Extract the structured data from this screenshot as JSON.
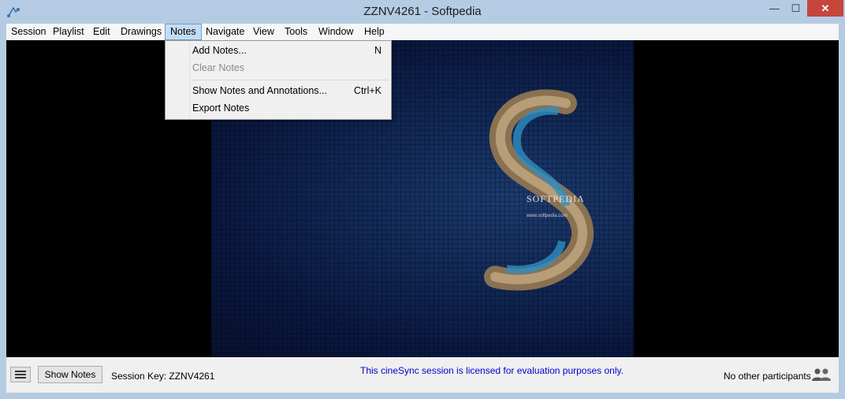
{
  "window": {
    "title": "ZZNV4261 - Softpedia",
    "minimize_glyph": "—",
    "maximize_glyph": "☐",
    "close_glyph": "✕"
  },
  "menubar": {
    "items": [
      "Session",
      "Playlist",
      "Edit",
      "Drawings",
      "Notes",
      "Navigate",
      "View",
      "Tools",
      "Window",
      "Help"
    ],
    "active": "Notes"
  },
  "notes_menu": {
    "items": [
      {
        "label": "Add Notes...",
        "shortcut": "N",
        "enabled": true
      },
      {
        "label": "Clear Notes",
        "shortcut": "",
        "enabled": false
      },
      {
        "label": "Show Notes and Annotations...",
        "shortcut": "Ctrl+K",
        "enabled": true
      },
      {
        "label": "Export Notes",
        "shortcut": "",
        "enabled": true
      }
    ]
  },
  "image": {
    "watermark": "SOFTPEDIA",
    "url": "www.softpedia.com"
  },
  "statusbar": {
    "list_icon": "list-icon",
    "show_notes_label": "Show Notes",
    "session_key": "Session Key: ZZNV4261",
    "license_notice": "This cineSync session is licensed for evaluation purposes only.",
    "participants": "No other participants",
    "participants_icon": "people-icon"
  },
  "colors": {
    "frame": "#b4cbe3",
    "close_button": "#c7463b",
    "license_text": "#0000cc",
    "menu_highlight": "#c4dcf3"
  }
}
